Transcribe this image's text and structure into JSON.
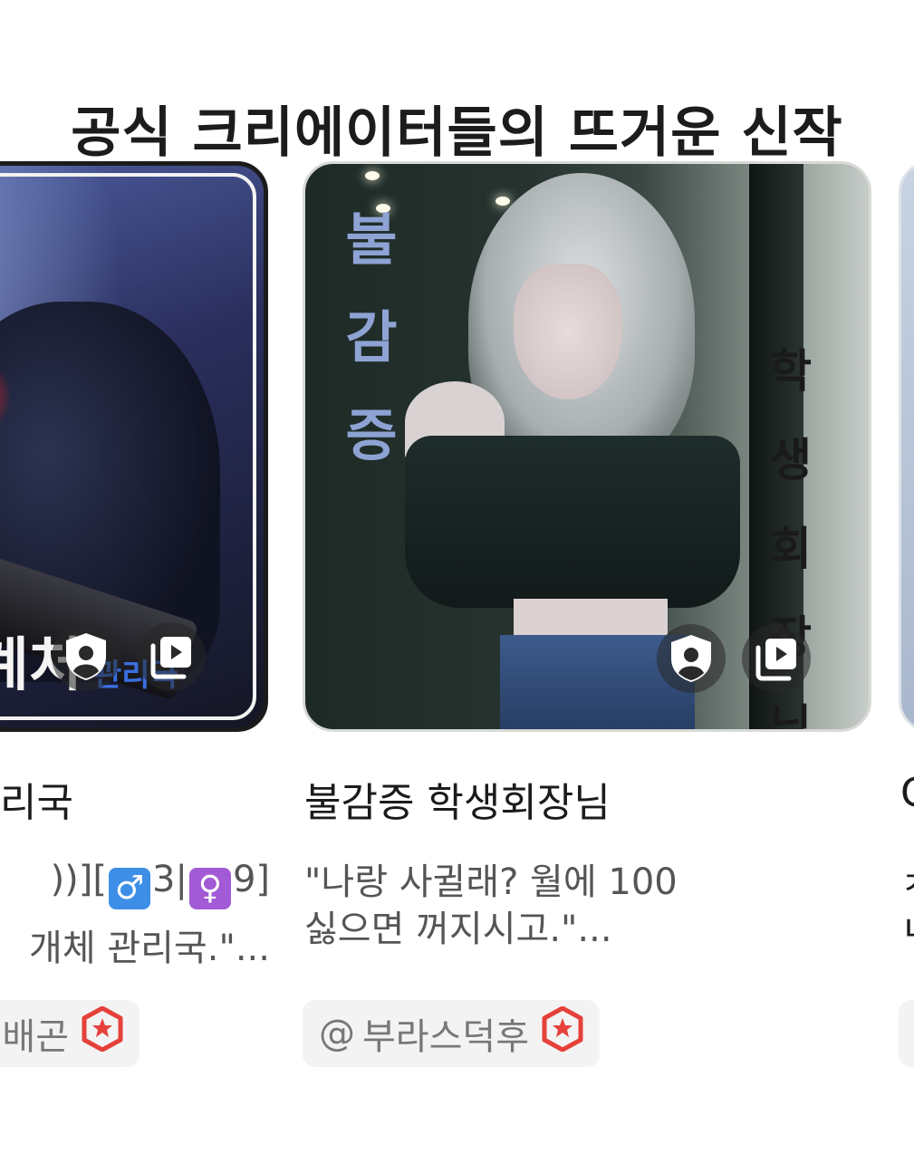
{
  "section": {
    "title": "공식 크리에이터들의 뜨거운 신작"
  },
  "cards": [
    {
      "cover_text": "계처",
      "cover_sub": "관리국",
      "title": "리국",
      "desc_line1_prefix": "))][",
      "male_glyph": "♂",
      "male_count": "3|",
      "female_glyph": "♀",
      "female_count": "9]",
      "desc_line2": "개체 관리국.\"...",
      "creator": "배곤"
    },
    {
      "cover_left": "불감증",
      "cover_right": "학생회장님",
      "title": "불감증 학생회장님",
      "desc": "\"나랑 사귈래? 월에 100\n싫으면 꺼지시고.\"...",
      "creator_at": "@",
      "creator": "부라스덕후"
    },
    {
      "title": "C",
      "desc": "ㅊ\nㄴ"
    }
  ],
  "icons": {
    "profile": "profile-shield-icon",
    "images": "image-stack-icon",
    "creator_badge": "official-star-badge-icon"
  },
  "colors": {
    "badge_red": "#e5413a",
    "male_bg": "#3d8ee6",
    "female_bg": "#a35ad6"
  }
}
